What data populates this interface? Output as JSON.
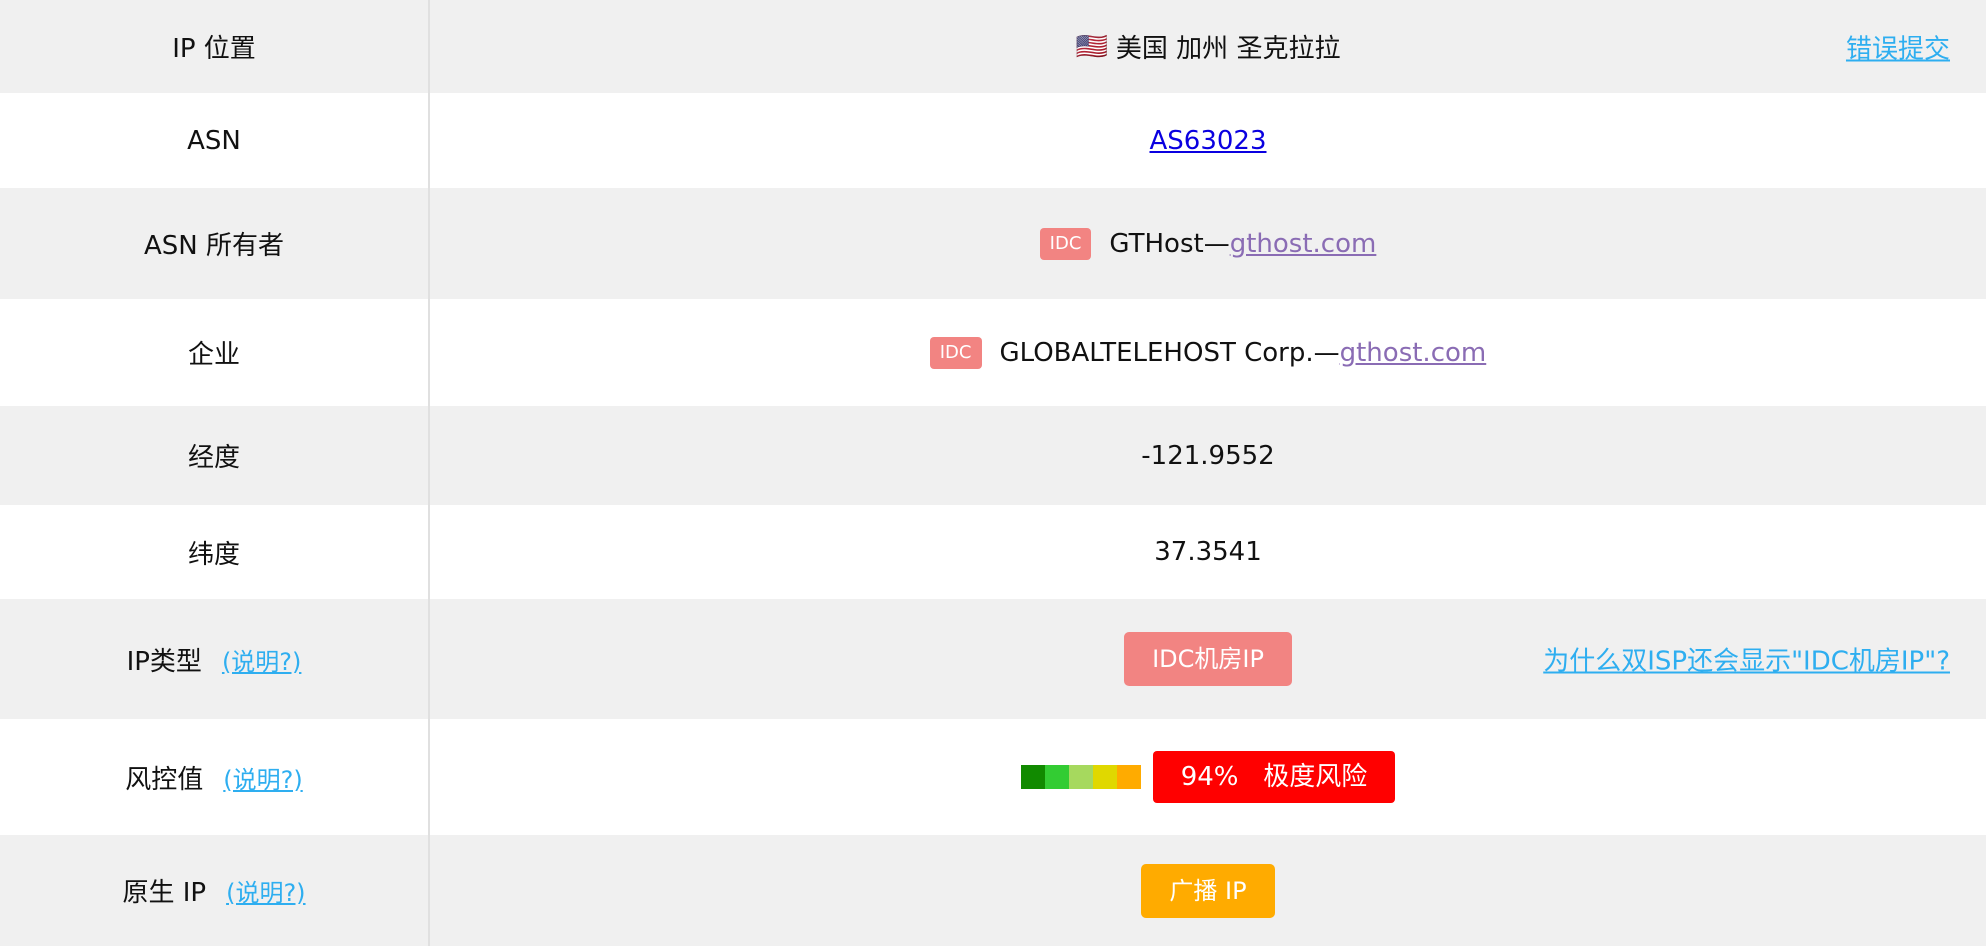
{
  "rows": {
    "location": {
      "label": "IP 位置",
      "flag": "🇺🇸",
      "value": "美国 加州 圣克拉拉",
      "report_link": "错误提交"
    },
    "asn": {
      "label": "ASN",
      "value": "AS63023"
    },
    "asn_owner": {
      "label": "ASN 所有者",
      "badge": "IDC",
      "name": "GTHost—",
      "link": "gthost.com"
    },
    "company": {
      "label": "企业",
      "badge": "IDC",
      "name": "GLOBALTELEHOST Corp.—",
      "link": "gthost.com"
    },
    "longitude": {
      "label": "经度",
      "value": "-121.9552"
    },
    "latitude": {
      "label": "纬度",
      "value": "37.3541"
    },
    "ip_type": {
      "label": "IP类型",
      "help": "(说明?)",
      "pill": "IDC机房IP",
      "side_link": "为什么双ISP还会显示\"IDC机房IP\"?"
    },
    "risk": {
      "label": "风控值",
      "help": "(说明?)",
      "percent": "94%",
      "level": "极度风险",
      "score": 0.94,
      "scale_colors": [
        "#118a00",
        "#33cc33",
        "#a6d95e",
        "#e0d800",
        "#ffab00"
      ]
    },
    "native": {
      "label": "原生 IP",
      "help": "(说明?)",
      "pill": "广播 IP"
    }
  },
  "colors": {
    "link": "#2eaef0",
    "idc_badge": "#f28482",
    "risk_extreme": "#ff0000",
    "broadcast": "#ffab00"
  }
}
